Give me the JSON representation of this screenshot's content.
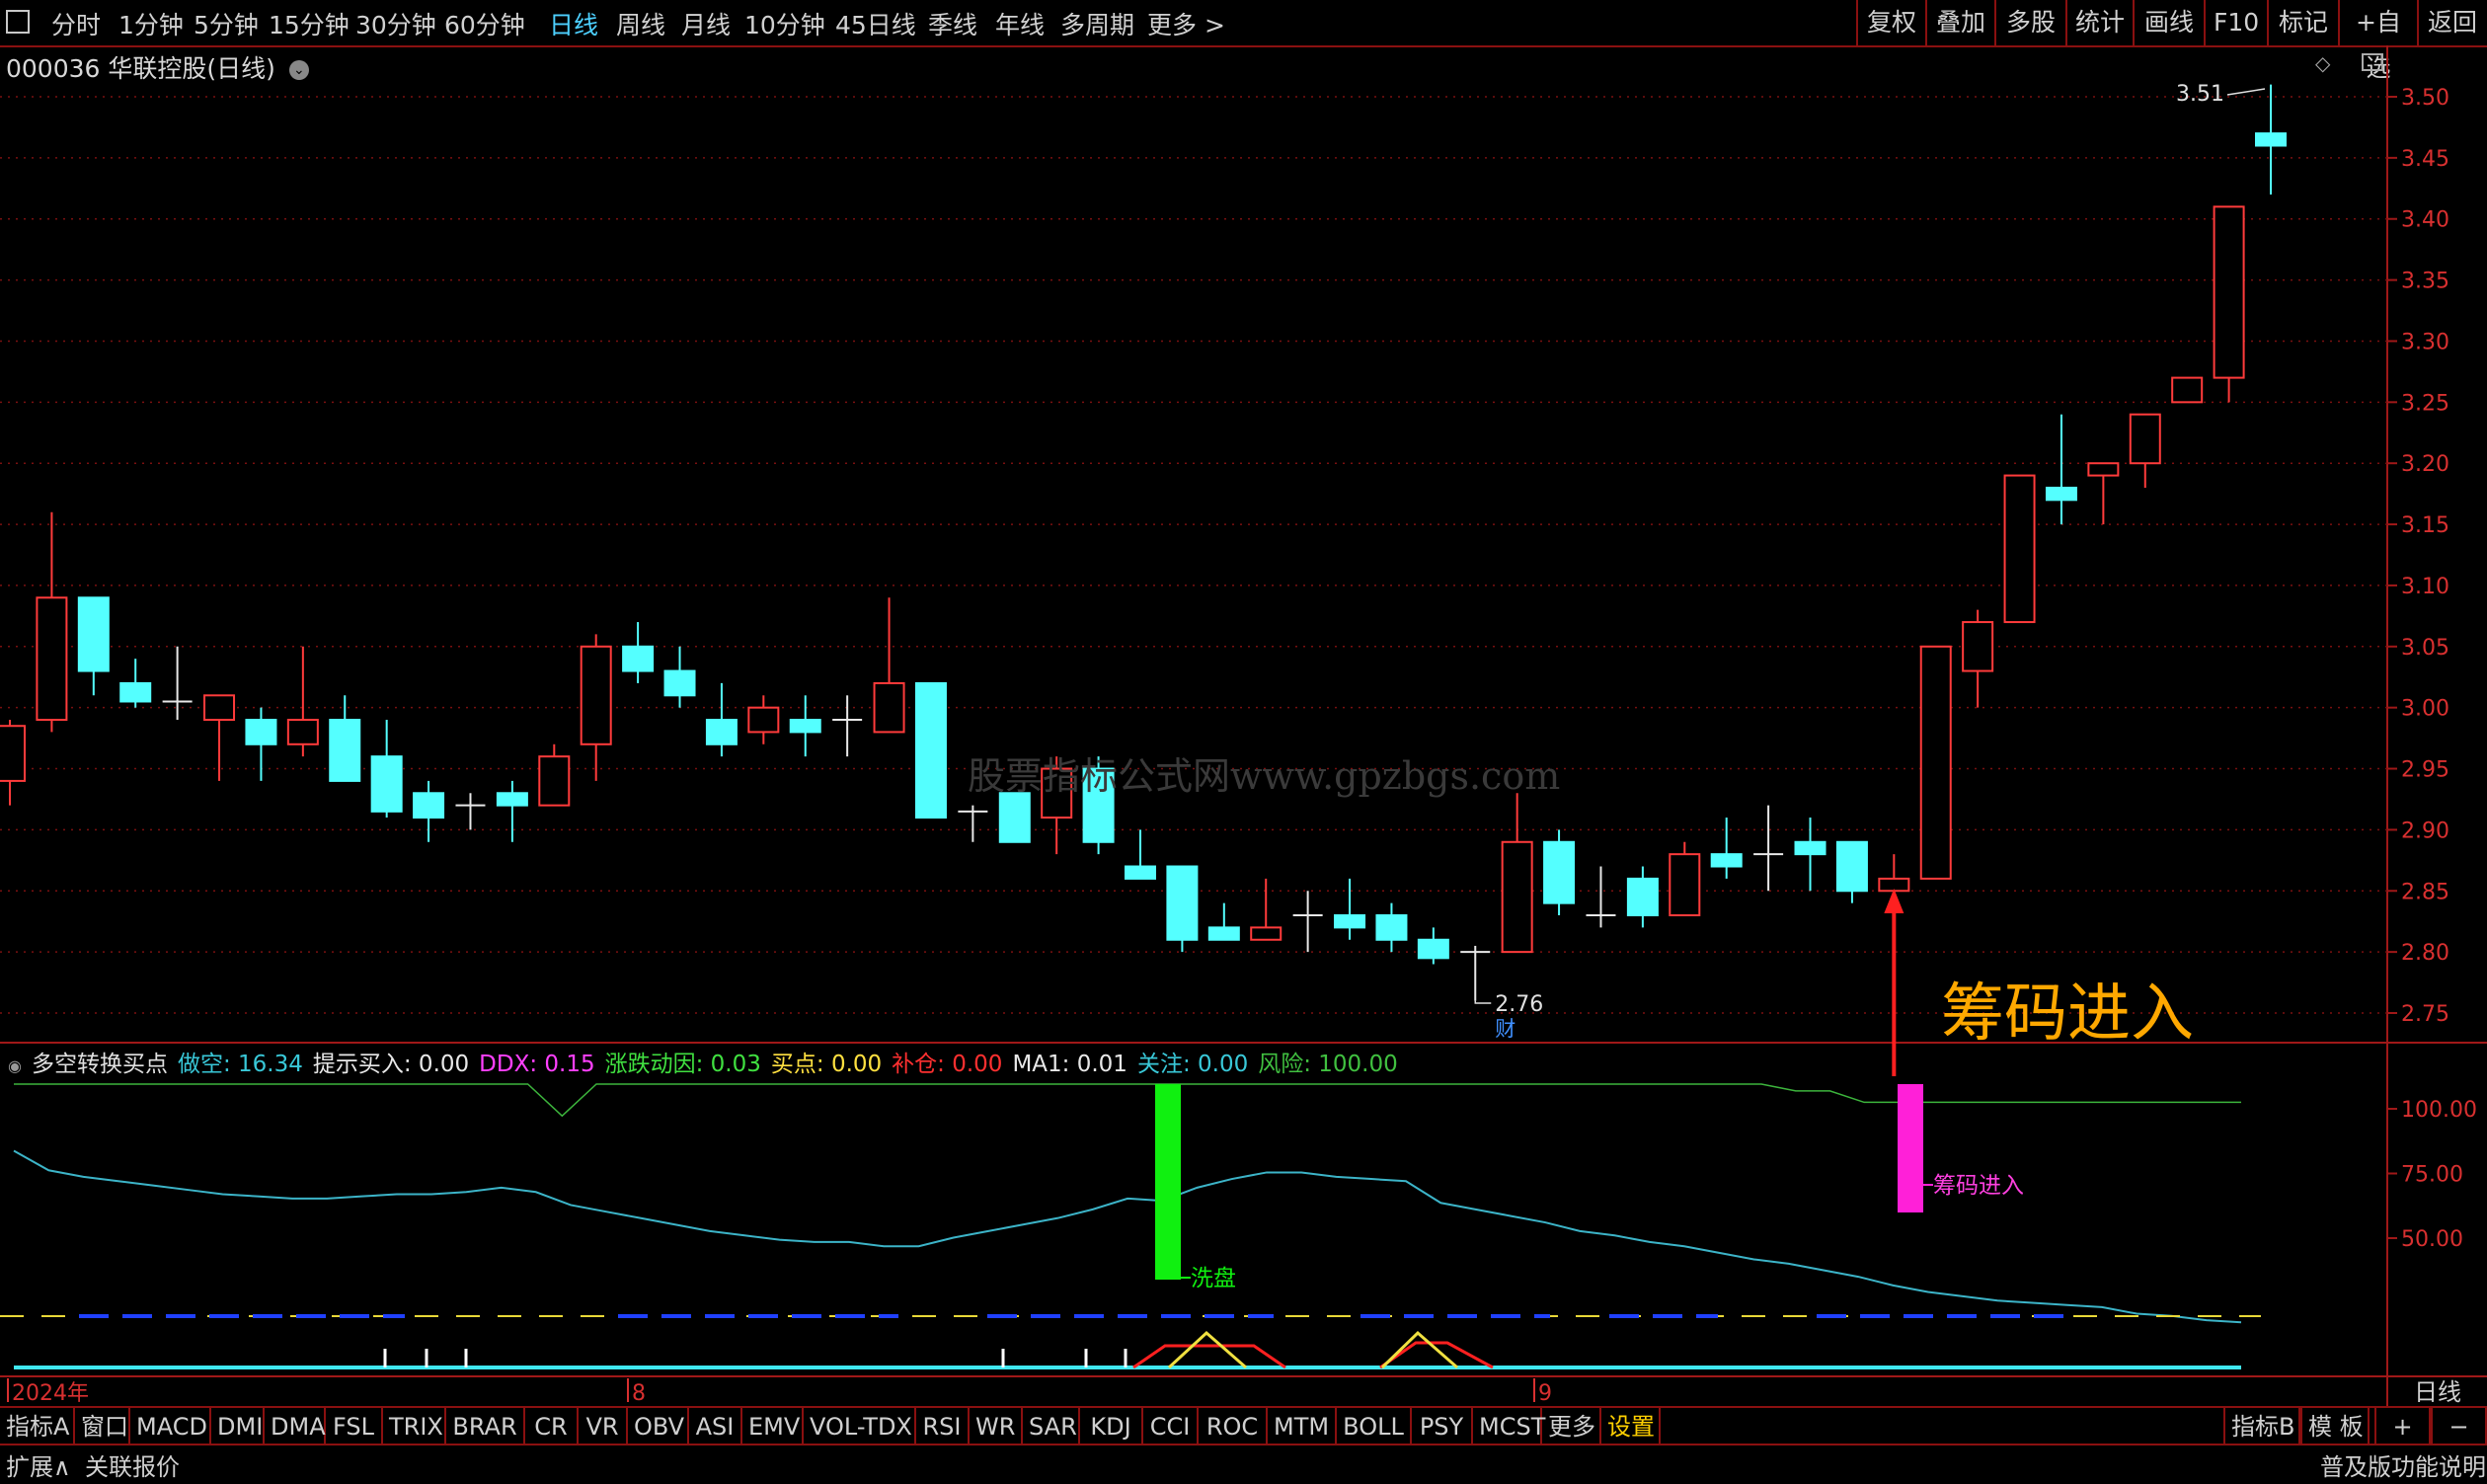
{
  "toolbar": {
    "periods": [
      "分时",
      "1分钟",
      "5分钟",
      "15分钟",
      "30分钟",
      "60分钟",
      "日线",
      "周线",
      "月线",
      "10分钟",
      "45日线",
      "季线",
      "年线",
      "多周期",
      "更多 >"
    ],
    "active_period": "日线",
    "right_buttons": [
      "复权",
      "叠加",
      "多股",
      "统计",
      "画线",
      "F10",
      "标记",
      "+自选",
      "返回"
    ]
  },
  "chart_title": "000036 华联控股(日线)",
  "price_axis": [
    "3.50",
    "3.45",
    "3.40",
    "3.35",
    "3.30",
    "3.25",
    "3.20",
    "3.15",
    "3.10",
    "3.05",
    "3.00",
    "2.95",
    "2.90",
    "2.85",
    "2.80",
    "2.75"
  ],
  "high_label": "3.51",
  "low_label": "2.76",
  "cai_label": "财",
  "watermark": "股票指标公式网www.gpzbgs.com",
  "annotation_main": "筹码进入",
  "indicator": {
    "name": "多空转换买点",
    "fields": [
      {
        "label": "做空",
        "value": "16.34",
        "color": "#39c8d8"
      },
      {
        "label": "提示买入",
        "value": "0.00",
        "color": "#e8e8e8"
      },
      {
        "label": "DDX",
        "value": "0.15",
        "color": "#ff40ff"
      },
      {
        "label": "涨跌动因",
        "value": "0.03",
        "color": "#40e040"
      },
      {
        "label": "买点",
        "value": "0.00",
        "color": "#ffe040"
      },
      {
        "label": "补仓",
        "value": "0.00",
        "color": "#ff3030"
      },
      {
        "label": "MA1",
        "value": "0.01",
        "color": "#e8e8e8"
      },
      {
        "label": "关注",
        "value": "0.00",
        "color": "#39c8d8"
      },
      {
        "label": "风险",
        "value": "100.00",
        "color": "#40c040"
      }
    ],
    "axis": [
      "100.00",
      "75.00",
      "50.00"
    ],
    "label_wash": "洗盘",
    "label_chip": "筹码进入"
  },
  "date_axis": {
    "year": "2024年",
    "m8": "8",
    "m9": "9",
    "period": "日线"
  },
  "tabs": [
    "指标A",
    "窗口",
    "MACD",
    "DMI",
    "DMA",
    "FSL",
    "TRIX",
    "BRAR",
    "CR",
    "VR",
    "OBV",
    "ASI",
    "EMV",
    "VOL-TDX",
    "RSI",
    "WR",
    "SAR",
    "KDJ",
    "CCI",
    "ROC",
    "MTM",
    "BOLL",
    "PSY",
    "MCST",
    "更多",
    "设置"
  ],
  "active_tab": "设置",
  "tabs_right": [
    "指标B",
    "模 板",
    "+",
    "−"
  ],
  "status": {
    "left1": "扩展∧",
    "left2": "关联报价",
    "right": "普及版功能说明"
  },
  "chart_data": {
    "type": "candlestick",
    "title": "000036 华联控股(日线)",
    "ylim": [
      2.73,
      3.52
    ],
    "up_color": "#ff3b3b",
    "down_color": "#54ffff",
    "candles": [
      {
        "o": 2.94,
        "h": 2.99,
        "l": 2.92,
        "c": 2.985
      },
      {
        "o": 2.99,
        "h": 3.16,
        "l": 2.98,
        "c": 3.09
      },
      {
        "o": 3.09,
        "h": 3.09,
        "l": 3.01,
        "c": 3.03
      },
      {
        "o": 3.02,
        "h": 3.04,
        "l": 3.0,
        "c": 3.005
      },
      {
        "o": 3.005,
        "h": 3.05,
        "l": 2.99,
        "c": 3.005
      },
      {
        "o": 2.99,
        "h": 3.01,
        "l": 2.94,
        "c": 3.01
      },
      {
        "o": 2.99,
        "h": 3.0,
        "l": 2.94,
        "c": 2.97
      },
      {
        "o": 2.97,
        "h": 3.05,
        "l": 2.96,
        "c": 2.99
      },
      {
        "o": 2.99,
        "h": 3.01,
        "l": 2.95,
        "c": 2.94
      },
      {
        "o": 2.96,
        "h": 2.99,
        "l": 2.91,
        "c": 2.915
      },
      {
        "o": 2.93,
        "h": 2.94,
        "l": 2.89,
        "c": 2.91
      },
      {
        "o": 2.92,
        "h": 2.93,
        "l": 2.9,
        "c": 2.92
      },
      {
        "o": 2.93,
        "h": 2.94,
        "l": 2.89,
        "c": 2.92
      },
      {
        "o": 2.92,
        "h": 2.97,
        "l": 2.92,
        "c": 2.96
      },
      {
        "o": 2.97,
        "h": 3.06,
        "l": 2.94,
        "c": 3.05
      },
      {
        "o": 3.05,
        "h": 3.07,
        "l": 3.02,
        "c": 3.03
      },
      {
        "o": 3.03,
        "h": 3.05,
        "l": 3.0,
        "c": 3.01
      },
      {
        "o": 2.99,
        "h": 3.02,
        "l": 2.96,
        "c": 2.97
      },
      {
        "o": 2.98,
        "h": 3.01,
        "l": 2.97,
        "c": 3.0
      },
      {
        "o": 2.99,
        "h": 3.01,
        "l": 2.96,
        "c": 2.98
      },
      {
        "o": 2.99,
        "h": 3.01,
        "l": 2.96,
        "c": 2.99
      },
      {
        "o": 2.98,
        "h": 3.09,
        "l": 2.98,
        "c": 3.02
      },
      {
        "o": 3.02,
        "h": 3.02,
        "l": 2.91,
        "c": 2.91
      },
      {
        "o": 2.915,
        "h": 2.92,
        "l": 2.89,
        "c": 2.915
      },
      {
        "o": 2.93,
        "h": 2.93,
        "l": 2.89,
        "c": 2.89
      },
      {
        "o": 2.91,
        "h": 2.96,
        "l": 2.88,
        "c": 2.95
      },
      {
        "o": 2.95,
        "h": 2.96,
        "l": 2.88,
        "c": 2.89
      },
      {
        "o": 2.87,
        "h": 2.9,
        "l": 2.86,
        "c": 2.86
      },
      {
        "o": 2.87,
        "h": 2.87,
        "l": 2.8,
        "c": 2.81
      },
      {
        "o": 2.82,
        "h": 2.84,
        "l": 2.81,
        "c": 2.81
      },
      {
        "o": 2.81,
        "h": 2.86,
        "l": 2.81,
        "c": 2.82
      },
      {
        "o": 2.83,
        "h": 2.85,
        "l": 2.8,
        "c": 2.83
      },
      {
        "o": 2.83,
        "h": 2.86,
        "l": 2.81,
        "c": 2.82
      },
      {
        "o": 2.83,
        "h": 2.84,
        "l": 2.8,
        "c": 2.81
      },
      {
        "o": 2.81,
        "h": 2.82,
        "l": 2.79,
        "c": 2.795
      },
      {
        "o": 2.8,
        "h": 2.805,
        "l": 2.76,
        "c": 2.8
      },
      {
        "o": 2.8,
        "h": 2.93,
        "l": 2.8,
        "c": 2.89
      },
      {
        "o": 2.89,
        "h": 2.9,
        "l": 2.83,
        "c": 2.84
      },
      {
        "o": 2.83,
        "h": 2.87,
        "l": 2.82,
        "c": 2.83
      },
      {
        "o": 2.86,
        "h": 2.87,
        "l": 2.82,
        "c": 2.83
      },
      {
        "o": 2.83,
        "h": 2.89,
        "l": 2.83,
        "c": 2.88
      },
      {
        "o": 2.88,
        "h": 2.91,
        "l": 2.86,
        "c": 2.87
      },
      {
        "o": 2.88,
        "h": 2.92,
        "l": 2.85,
        "c": 2.88
      },
      {
        "o": 2.89,
        "h": 2.91,
        "l": 2.85,
        "c": 2.88
      },
      {
        "o": 2.89,
        "h": 2.89,
        "l": 2.84,
        "c": 2.85
      },
      {
        "o": 2.85,
        "h": 2.88,
        "l": 2.84,
        "c": 2.86
      },
      {
        "o": 2.86,
        "h": 3.05,
        "l": 2.86,
        "c": 3.05
      },
      {
        "o": 3.03,
        "h": 3.08,
        "l": 3.0,
        "c": 3.07
      },
      {
        "o": 3.07,
        "h": 3.19,
        "l": 3.07,
        "c": 3.19
      },
      {
        "o": 3.18,
        "h": 3.24,
        "l": 3.15,
        "c": 3.17
      },
      {
        "o": 3.19,
        "h": 3.2,
        "l": 3.15,
        "c": 3.2
      },
      {
        "o": 3.2,
        "h": 3.24,
        "l": 3.18,
        "c": 3.24
      },
      {
        "o": 3.25,
        "h": 3.27,
        "l": 3.25,
        "c": 3.27
      },
      {
        "o": 3.27,
        "h": 3.39,
        "l": 3.25,
        "c": 3.41
      },
      {
        "o": 3.47,
        "h": 3.51,
        "l": 3.42,
        "c": 3.46
      }
    ],
    "indicator_series": {
      "做空": [
        95,
        86,
        83,
        81,
        79,
        77,
        75,
        74,
        73,
        73,
        74,
        75,
        75,
        76,
        78,
        76,
        70,
        67,
        64,
        61,
        58,
        56,
        54,
        53,
        53,
        51,
        51,
        55,
        58,
        61,
        64,
        68,
        73,
        72,
        78,
        82,
        85,
        85,
        83,
        82,
        81,
        71,
        68,
        65,
        62,
        58,
        56,
        53,
        51,
        48,
        45,
        43,
        40,
        37,
        33,
        30,
        28,
        26,
        25,
        24,
        23,
        20,
        19,
        17,
        16
      ],
      "风险": [
        100,
        100,
        100,
        100,
        100,
        100,
        100,
        100,
        100,
        100,
        100,
        100,
        100,
        100,
        100,
        100,
        93,
        100,
        100,
        100,
        100,
        100,
        100,
        100,
        100,
        100,
        100,
        100,
        100,
        100,
        100,
        100,
        100,
        100,
        100,
        100,
        100,
        100,
        100,
        100,
        100,
        100,
        100,
        100,
        100,
        100,
        100,
        100,
        100,
        100,
        100,
        100,
        100,
        100,
        100,
        100,
        100,
        100,
        100,
        100,
        100,
        100,
        100,
        100,
        100,
        100
      ],
      "wash_bar_value": 100,
      "chip_bar_value": 100
    }
  }
}
